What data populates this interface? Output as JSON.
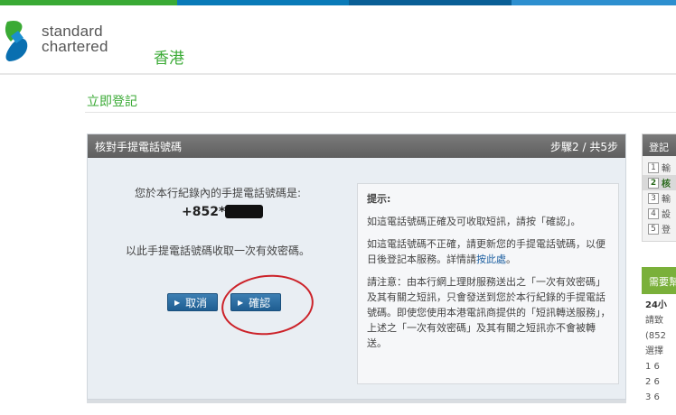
{
  "colors": {
    "stripe": [
      "#3aaa35",
      "#0a7ab8",
      "#0a5f96",
      "#2d8fcf"
    ],
    "brand_green": "#3aaa35",
    "button_blue": "#1f5e92",
    "annotation_red": "#cc2229"
  },
  "header": {
    "brand_line1": "standard",
    "brand_line2": "chartered",
    "region": "香港",
    "logo_icon": "standard-chartered-logo"
  },
  "page": {
    "title": "立即登記"
  },
  "panel": {
    "title": "核對手提電話號碼",
    "step": "步驟2 / 共5步",
    "line1": "您於本行紀錄內的手提電話號碼是:",
    "phone": "+852****",
    "line2": "以此手提電話號碼收取一次有效密碼。",
    "cancel_label": "取消",
    "confirm_label": "確認"
  },
  "tips": {
    "title": "提示:",
    "p1": "如這電話號碼正確及可收取短訊，請按「確認」。",
    "p2_text": "如這電話號碼不正確，請更新您的手提電話號碼，以便日後登記本服務。詳情請",
    "p2_link": "按此處",
    "p2_end": "。",
    "p3": "請注意：由本行網上理財服務送出之「一次有效密碼」及其有關之短訊，只會發送到您於本行紀錄的手提電話號碼。即使您使用本港電訊商提供的「短訊轉送服務」，上述之「一次有效密碼」及其有關之短訊亦不會被轉送。"
  },
  "sidebar": {
    "title": "登記",
    "steps": [
      {
        "num": "1",
        "label": "輸"
      },
      {
        "num": "2",
        "label": "核"
      },
      {
        "num": "3",
        "label": "輸"
      },
      {
        "num": "4",
        "label": "設"
      },
      {
        "num": "5",
        "label": "登"
      }
    ],
    "help_title": "需要幫",
    "help_lines": [
      "24小",
      "請致",
      "(852",
      "選擇",
      "1 6",
      "2 6",
      "3 6"
    ]
  }
}
